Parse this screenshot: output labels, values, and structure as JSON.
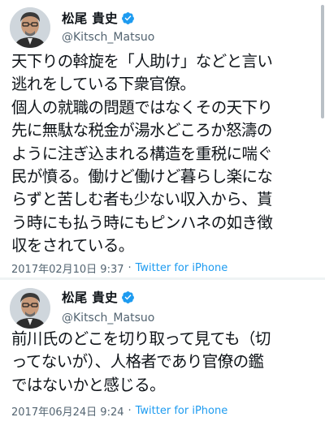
{
  "tweets": [
    {
      "author": {
        "display_name": "松尾 貴史",
        "handle": "@Kitsch_Matsuo",
        "verified": true,
        "avatar_icon": "avatar-photo"
      },
      "text": "天下りの斡旋を「人助け」などと言い\n逃れをしている下衆官僚。\n個人の就職の問題ではなくその天下り\n先に無駄な税金が湯水どころか怒濤の\nように注ぎ込まれる構造を重税に喘ぐ\n民が憤る。働けど働けど暮らし楽にな\nらずと苦しむ者も少ない収入から、貰\nう時にも払う時にもピンハネの如き徴\n収をされている。",
      "timestamp": "2017年02月10日 9:37",
      "separator": "·",
      "source": "Twitter for iPhone"
    },
    {
      "author": {
        "display_name": "松尾 貴史",
        "handle": "@Kitsch_Matsuo",
        "verified": true,
        "avatar_icon": "avatar-photo"
      },
      "text": "前川氏のどこを切り取って見ても（切\nってないが）、人格者であり官僚の鑑\nではないかと感じる。",
      "timestamp": "2017年06月24日 9:24",
      "separator": "·",
      "source": "Twitter for iPhone"
    }
  ],
  "colors": {
    "text": "#0f1419",
    "secondary": "#536471",
    "accent": "#1d9bf0",
    "divider": "#eff3f4"
  }
}
